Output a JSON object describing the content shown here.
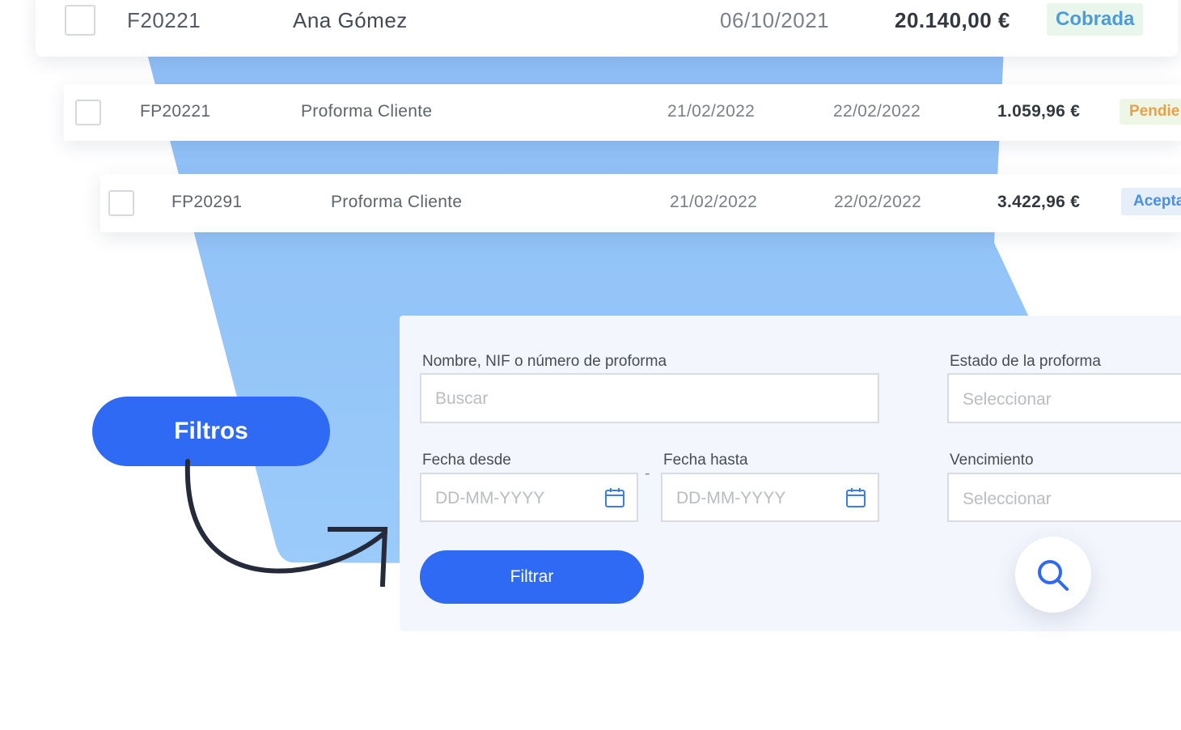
{
  "rows": [
    {
      "number": "F20221",
      "client": "Ana Gómez",
      "date": "06/10/2021",
      "amount": "20.140,00 €",
      "status": "Cobrada"
    },
    {
      "number": "FP20221",
      "client": "Proforma Cliente",
      "date": "21/02/2022",
      "due_date": "22/02/2022",
      "amount": "1.059,96 €",
      "status": "Pendie"
    },
    {
      "number": "FP20291",
      "client": "Proforma Cliente",
      "date": "21/02/2022",
      "due_date": "22/02/2022",
      "amount": "3.422,96 €",
      "status": "Acepta"
    }
  ],
  "callout": {
    "label": "Filtros"
  },
  "filters": {
    "search_label": "Nombre, NIF o número de proforma",
    "search_placeholder": "Buscar",
    "status_label": "Estado de la proforma",
    "status_placeholder": "Seleccionar",
    "date_from_label": "Fecha desde",
    "date_from_placeholder": "DD-MM-YYYY",
    "date_separator": "-",
    "date_to_label": "Fecha hasta",
    "date_to_placeholder": "DD-MM-YYYY",
    "due_label": "Vencimiento",
    "due_placeholder": "Seleccionar",
    "filter_button": "Filtrar"
  },
  "icons": {
    "calendar": "calendar-icon",
    "search": "search-icon",
    "arrow": "curved-arrow-icon"
  },
  "colors": {
    "accent_blue": "#2f6af5",
    "background_shape": "#91c1f8",
    "panel_background": "#f3f6fd",
    "status_paid": "#4f9bd6",
    "status_pending": "#e8a04a",
    "status_accepted": "#4a8fe0"
  }
}
